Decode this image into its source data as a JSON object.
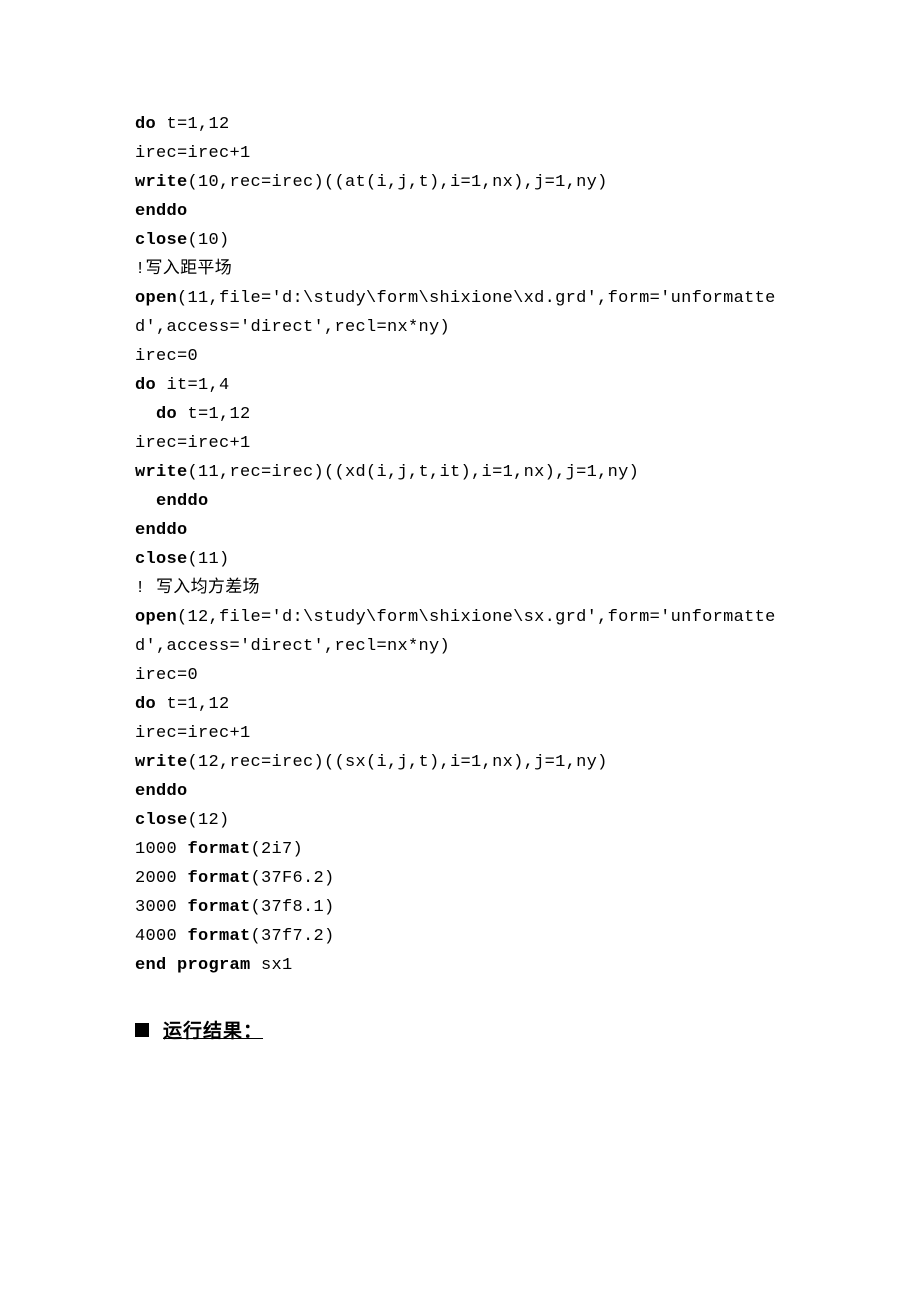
{
  "code": {
    "lines": [
      {
        "segments": [
          {
            "t": "do",
            "b": true
          },
          {
            "t": " t=1,12"
          }
        ]
      },
      {
        "segments": [
          {
            "t": "irec=irec+1"
          }
        ]
      },
      {
        "segments": [
          {
            "t": "write",
            "b": true
          },
          {
            "t": "(10,rec=irec)((at(i,j,t),i=1,nx),j=1,ny)"
          }
        ]
      },
      {
        "segments": [
          {
            "t": "enddo",
            "b": true
          }
        ]
      },
      {
        "segments": [
          {
            "t": "close",
            "b": true
          },
          {
            "t": "(10)"
          }
        ]
      },
      {
        "segments": [
          {
            "t": "!写入距平场"
          }
        ]
      },
      {
        "segments": [
          {
            "t": "open",
            "b": true
          },
          {
            "t": "(11,file='d:\\study\\form\\shixione\\xd.grd',form='unformatted',access='direct',recl=nx*ny)"
          }
        ]
      },
      {
        "segments": [
          {
            "t": "irec=0"
          }
        ]
      },
      {
        "segments": [
          {
            "t": "do",
            "b": true
          },
          {
            "t": " it=1,4"
          }
        ]
      },
      {
        "segments": [
          {
            "t": "  "
          },
          {
            "t": "do",
            "b": true
          },
          {
            "t": " t=1,12"
          }
        ]
      },
      {
        "segments": [
          {
            "t": "irec=irec+1"
          }
        ]
      },
      {
        "segments": [
          {
            "t": "write",
            "b": true
          },
          {
            "t": "(11,rec=irec)((xd(i,j,t,it),i=1,nx),j=1,ny)"
          }
        ]
      },
      {
        "segments": [
          {
            "t": "  "
          },
          {
            "t": "enddo",
            "b": true
          }
        ]
      },
      {
        "segments": [
          {
            "t": "enddo",
            "b": true
          }
        ]
      },
      {
        "segments": [
          {
            "t": "close",
            "b": true
          },
          {
            "t": "(11)"
          }
        ]
      },
      {
        "segments": [
          {
            "t": "! 写入均方差场"
          }
        ]
      },
      {
        "segments": [
          {
            "t": "open",
            "b": true
          },
          {
            "t": "(12,file='d:\\study\\form\\shixione\\sx.grd',form='unformatted',access='direct',recl=nx*ny)"
          }
        ]
      },
      {
        "segments": [
          {
            "t": "irec=0"
          }
        ]
      },
      {
        "segments": [
          {
            "t": "do",
            "b": true
          },
          {
            "t": " t=1,12"
          }
        ]
      },
      {
        "segments": [
          {
            "t": "irec=irec+1"
          }
        ]
      },
      {
        "segments": [
          {
            "t": "write",
            "b": true
          },
          {
            "t": "(12,rec=irec)((sx(i,j,t),i=1,nx),j=1,ny)"
          }
        ]
      },
      {
        "segments": [
          {
            "t": "enddo",
            "b": true
          }
        ]
      },
      {
        "segments": [
          {
            "t": "close",
            "b": true
          },
          {
            "t": "(12)"
          }
        ]
      },
      {
        "segments": [
          {
            "t": "1000 "
          },
          {
            "t": "format",
            "b": true
          },
          {
            "t": "(2i7)"
          }
        ]
      },
      {
        "segments": [
          {
            "t": "2000 "
          },
          {
            "t": "format",
            "b": true
          },
          {
            "t": "(37F6.2)"
          }
        ]
      },
      {
        "segments": [
          {
            "t": "3000 "
          },
          {
            "t": "format",
            "b": true
          },
          {
            "t": "(37f8.1)"
          }
        ]
      },
      {
        "segments": [
          {
            "t": "4000 "
          },
          {
            "t": "format",
            "b": true
          },
          {
            "t": "(37f7.2)"
          }
        ]
      },
      {
        "segments": [
          {
            "t": "end program",
            "b": true
          },
          {
            "t": " sx1"
          }
        ]
      }
    ]
  },
  "section": {
    "title": "运行结果："
  }
}
